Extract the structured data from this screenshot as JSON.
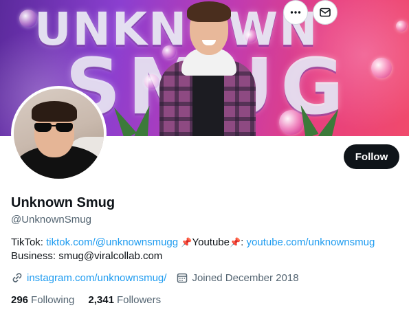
{
  "banner": {
    "line1": "UNKNOWN",
    "line2": "SMUG"
  },
  "profile": {
    "display_name": "Unknown Smug",
    "handle": "@UnknownSmug"
  },
  "actions": {
    "more_icon": "more-horizontal-icon",
    "message_icon": "mail-icon",
    "follow_label": "Follow"
  },
  "bio": {
    "tiktok_label": "TikTok: ",
    "tiktok_link": "tiktok.com/@unknownsmugg",
    "pin1": "📌",
    "youtube_label": "Youtube",
    "pin2": "📌",
    "colon": ": ",
    "youtube_link": "youtube.com/unknownsmug",
    "business_line": "Business: smug@viralcollab.com"
  },
  "meta": {
    "website_icon": "link-icon",
    "website": "instagram.com/unknownsmug/",
    "joined_icon": "calendar-icon",
    "joined": "Joined December 2018"
  },
  "stats": {
    "following_count": "296",
    "following_label": "Following",
    "followers_count": "2,341",
    "followers_label": "Followers"
  },
  "colors": {
    "accent": "#1d9bf0",
    "follow_button": "#0f1419",
    "secondary_text": "#536471"
  }
}
